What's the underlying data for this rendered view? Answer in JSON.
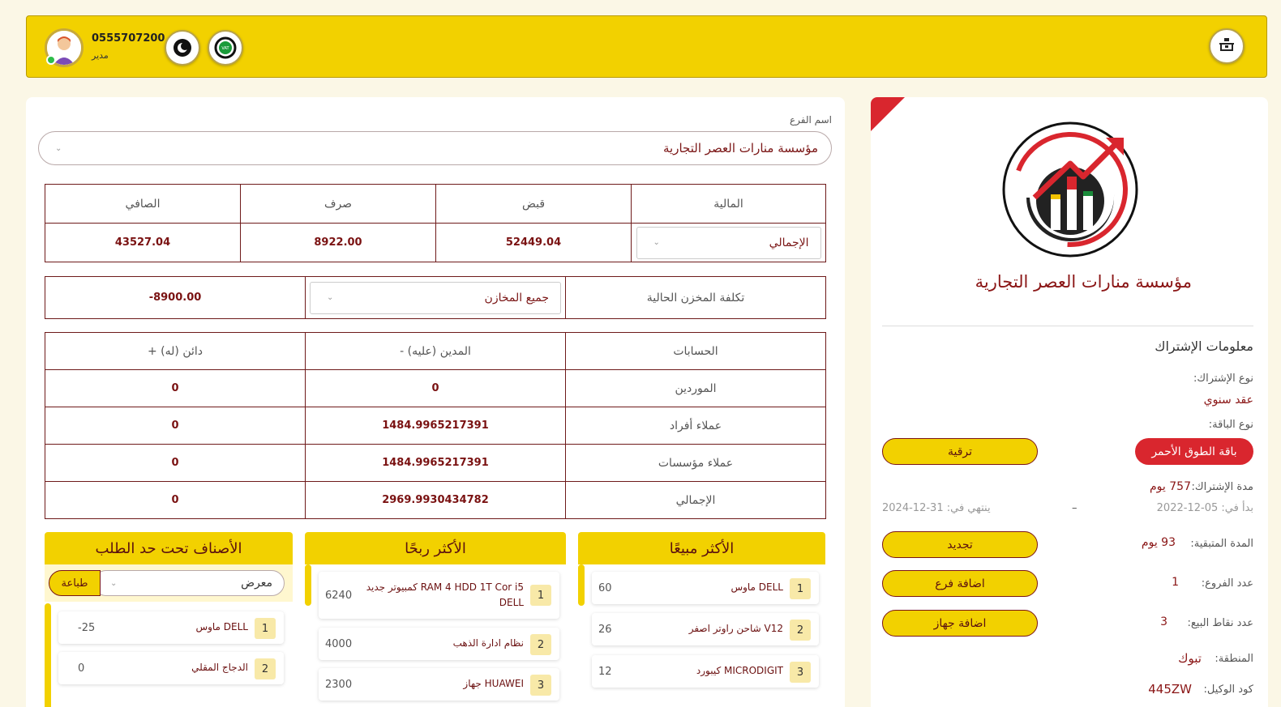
{
  "header": {
    "phone": "0555707200",
    "role": "مدير",
    "menu_icon": "drawer-icon",
    "theme_icon": "moon-icon",
    "vat_icon": "vat-icon",
    "vat_badge": "VAT"
  },
  "main": {
    "branch_label": "اسم الفرع",
    "branch_value": "مؤسسة منارات العصر التجارية",
    "finance": {
      "headers": [
        "المالية",
        "قبض",
        "صرف",
        "الصافي"
      ],
      "select_value": "الإجمالي",
      "receipts": "52449.04",
      "expenses": "8922.00",
      "net": "43527.04"
    },
    "inventory": {
      "label": "تكلفة المخزن الحالية",
      "select_value": "جميع المخازن",
      "value": "-8900.00"
    },
    "accounts": {
      "headers": [
        "الحسابات",
        "- المدين (عليه)",
        "+ دائن (له)"
      ],
      "rows": [
        {
          "name": "الموردين",
          "debit": "0",
          "credit": "0"
        },
        {
          "name": "عملاء أفراد",
          "debit": "1484.9965217391",
          "credit": "0"
        },
        {
          "name": "عملاء مؤسسات",
          "debit": "1484.9965217391",
          "credit": "0"
        },
        {
          "name": "الإجمالي",
          "debit": "2969.9930434782",
          "credit": "0"
        }
      ]
    },
    "best_selling": {
      "title": "الأكثر مبيعًا",
      "items": [
        {
          "n": "1",
          "name": "ماوس DELL",
          "value": "60"
        },
        {
          "n": "2",
          "name": "شاحن راوتر اصفر V12",
          "value": "26"
        },
        {
          "n": "3",
          "name": "كيبورد MICRODIGIT",
          "value": "12"
        }
      ]
    },
    "most_profitable": {
      "title": "الأكثر ربحًا",
      "items": [
        {
          "n": "1",
          "name": "كمبيوتر جديد RAM 4 HDD 1T Cor i5 DELL",
          "value": "6240"
        },
        {
          "n": "2",
          "name": "نظام ادارة الذهب",
          "value": "4000"
        },
        {
          "n": "3",
          "name": "جهاز HUAWEI",
          "value": "2300"
        }
      ]
    },
    "below_reorder": {
      "title": "الأصناف تحت حد الطلب",
      "filter_value": "معرض",
      "print_label": "طباعة",
      "items": [
        {
          "n": "1",
          "name": "ماوس DELL",
          "value": "-25"
        },
        {
          "n": "2",
          "name": "الدجاج المقلي",
          "value": "0"
        }
      ]
    }
  },
  "side": {
    "company_name": "مؤسسة منارات العصر التجارية",
    "section_title": "معلومات الإشتراك",
    "sub_type_label": "نوع الإشتراك:",
    "sub_type_value": "عقد سنوي",
    "package_label": "نوع الباقة:",
    "package_value": "باقة الطوق الأحمر",
    "upgrade_label": "ترقية",
    "duration_label": "مدة الإشتراك:",
    "duration_value": "757 يوم",
    "start_label": "بدأ في: 05-12-2022",
    "dash": "–",
    "end_label": "ينتهي في: 31-12-2024",
    "remaining_label": "المدة المتبقية:",
    "remaining_value": "93 يوم",
    "renew_label": "تجديد",
    "branches_label": "عدد الفروع:",
    "branches_value": "1",
    "add_branch_label": "اضافة فرع",
    "pos_label": "عدد نقاط البيع:",
    "pos_value": "3",
    "add_device_label": "اضافة جهاز",
    "region_label": "المنطقة:",
    "region_value": "تبوك",
    "agent_label": "كود الوكيل:",
    "agent_value": "445ZW"
  },
  "colors": {
    "accent": "#f2d100",
    "brand_red": "#d9262e",
    "text_dark_red": "#7a1515"
  }
}
